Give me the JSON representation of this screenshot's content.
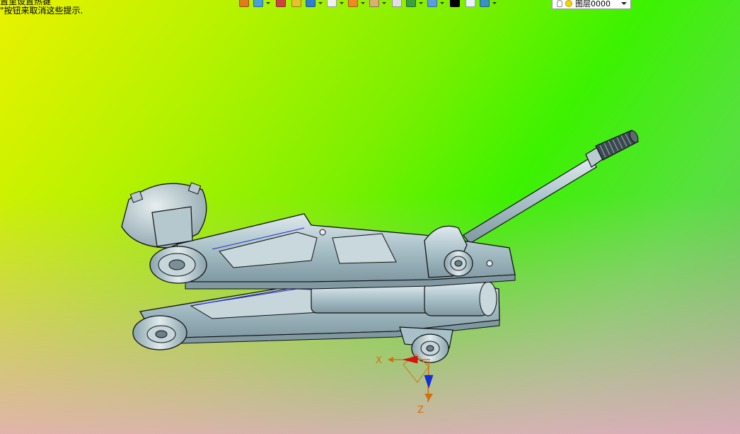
{
  "viewport": {
    "hint_line1": "置里设置热键",
    "hint_line2": "\"按钮来取消这些提示."
  },
  "toolbar": {
    "buttons": [
      {
        "icon": "exit-icon",
        "color": "#e07a1a",
        "dropdown": false
      },
      {
        "icon": "view-icon",
        "color": "#4aa0d8",
        "dropdown": true
      },
      {
        "icon": "pencil-icon",
        "color": "#d04040",
        "dropdown": false
      },
      {
        "icon": "solid-yellow-icon",
        "color": "#e6c22a",
        "dropdown": false
      },
      {
        "icon": "cube-blue-icon",
        "color": "#2f7fd0",
        "dropdown": true
      },
      {
        "icon": "cube-white-icon",
        "color": "#f0f0f0",
        "dropdown": true
      },
      {
        "icon": "sphere-orange-icon",
        "color": "#f08a20",
        "dropdown": true
      },
      {
        "icon": "clipboard-icon",
        "color": "#d8b070",
        "dropdown": true
      },
      {
        "icon": "page-icon",
        "color": "#e0e0e0",
        "dropdown": false
      },
      {
        "icon": "frame-icon",
        "color": "#3aa040",
        "dropdown": true
      },
      {
        "icon": "monitor-icon",
        "color": "#5aa0e0",
        "dropdown": true
      },
      {
        "icon": "color-black-icon",
        "color": "#000000",
        "dropdown": false
      },
      {
        "icon": "color-white-icon",
        "color": "#e8f4ff",
        "dropdown": false
      },
      {
        "icon": "layers-icon",
        "color": "#3a90c0",
        "dropdown": true
      }
    ]
  },
  "layer": {
    "value": "图层0000"
  },
  "triad": {
    "x_label": "X",
    "z_label": "Z"
  },
  "colors": {
    "part_fill": "#a8c0c8",
    "part_light": "#d8e6ea",
    "part_dark": "#6f8a94",
    "outline": "#101010",
    "axis_x": "#e01010",
    "axis_z": "#1030e0",
    "axis_label": "#d07010"
  }
}
